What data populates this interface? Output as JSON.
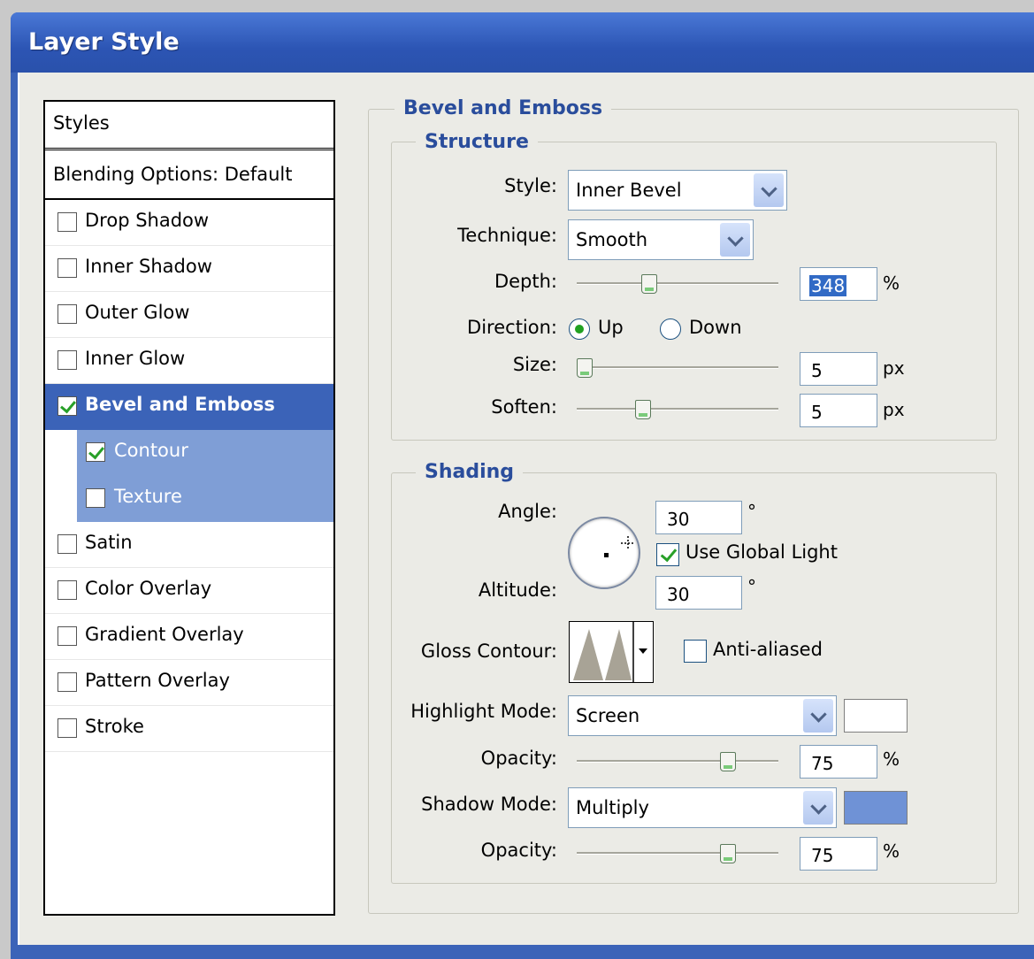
{
  "window": {
    "title": "Layer Style"
  },
  "styles_list": {
    "header": "Styles",
    "blending": "Blending Options: Default",
    "items": [
      {
        "label": "Drop Shadow",
        "checked": false
      },
      {
        "label": "Inner Shadow",
        "checked": false
      },
      {
        "label": "Outer Glow",
        "checked": false
      },
      {
        "label": "Inner Glow",
        "checked": false
      },
      {
        "label": "Bevel and Emboss",
        "checked": true,
        "selected": true
      },
      {
        "label": "Contour",
        "checked": true,
        "sub": true
      },
      {
        "label": "Texture",
        "checked": false,
        "sub": true
      },
      {
        "label": "Satin",
        "checked": false
      },
      {
        "label": "Color Overlay",
        "checked": false
      },
      {
        "label": "Gradient Overlay",
        "checked": false
      },
      {
        "label": "Pattern Overlay",
        "checked": false
      },
      {
        "label": "Stroke",
        "checked": false
      }
    ]
  },
  "panel": {
    "title": "Bevel and Emboss",
    "structure": {
      "title": "Structure",
      "style_label": "Style:",
      "style_value": "Inner Bevel",
      "technique_label": "Technique:",
      "technique_value": "Smooth",
      "depth_label": "Depth:",
      "depth_value": "348",
      "depth_unit": "%",
      "direction_label": "Direction:",
      "direction_up": "Up",
      "direction_down": "Down",
      "direction_selected": "Up",
      "size_label": "Size:",
      "size_value": "5",
      "size_unit": "px",
      "soften_label": "Soften:",
      "soften_value": "5",
      "soften_unit": "px"
    },
    "shading": {
      "title": "Shading",
      "angle_label": "Angle:",
      "angle_value": "30",
      "angle_unit": "°",
      "global_light_label": "Use Global Light",
      "global_light_checked": true,
      "altitude_label": "Altitude:",
      "altitude_value": "30",
      "altitude_unit": "°",
      "gloss_contour_label": "Gloss Contour:",
      "anti_aliased_label": "Anti-aliased",
      "anti_aliased_checked": false,
      "highlight_mode_label": "Highlight Mode:",
      "highlight_mode_value": "Screen",
      "highlight_color": "#ffffff",
      "highlight_opacity_label": "Opacity:",
      "highlight_opacity_value": "75",
      "highlight_opacity_unit": "%",
      "shadow_mode_label": "Shadow Mode:",
      "shadow_mode_value": "Multiply",
      "shadow_color": "#6f92d6",
      "shadow_opacity_label": "Opacity:",
      "shadow_opacity_value": "75",
      "shadow_opacity_unit": "%"
    }
  },
  "colors": {
    "accent": "#3b63b8",
    "subselection": "#7f9ed6",
    "group_title": "#2a4d9c"
  },
  "slider_levels": {
    "depth": 0.36,
    "size": 0.04,
    "soften": 0.33,
    "highlight_opacity": 0.75,
    "shadow_opacity": 0.75
  }
}
